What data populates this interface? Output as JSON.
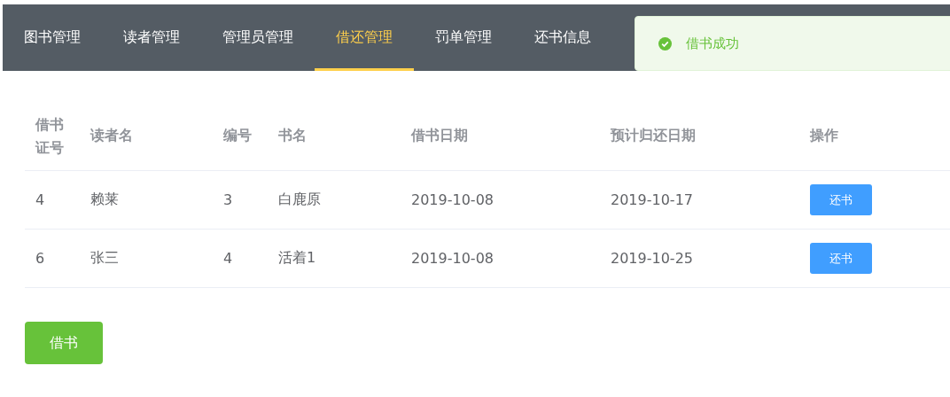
{
  "nav": {
    "items": [
      {
        "label": "图书管理",
        "selected": false
      },
      {
        "label": "读者管理",
        "selected": false
      },
      {
        "label": "管理员管理",
        "selected": false
      },
      {
        "label": "借还管理",
        "selected": true
      },
      {
        "label": "罚单管理",
        "selected": false
      },
      {
        "label": "还书信息",
        "selected": false
      }
    ]
  },
  "toast": {
    "kind": "success",
    "message": "借书成功"
  },
  "table": {
    "columns": [
      "借书证号",
      "读者名",
      "编号",
      "书名",
      "借书日期",
      "预计归还日期",
      "操作"
    ],
    "rows": [
      {
        "cells": [
          "4",
          "赖莱",
          "3",
          "白鹿原",
          "2019-10-08",
          "2019-10-17"
        ],
        "action": "还书"
      },
      {
        "cells": [
          "6",
          "张三",
          "4",
          "活着1",
          "2019-10-08",
          "2019-10-25"
        ],
        "action": "还书"
      }
    ]
  },
  "borrow_button": "借书"
}
